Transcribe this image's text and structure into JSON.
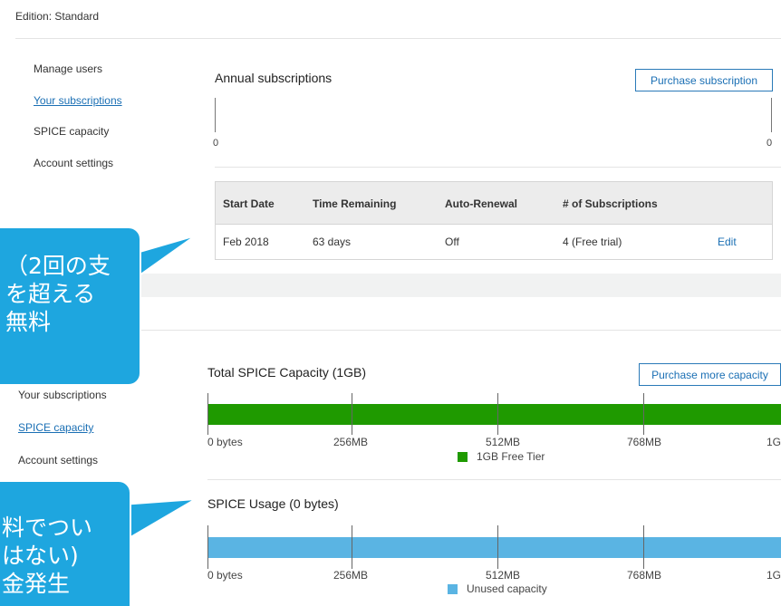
{
  "edition": "Edition: Standard",
  "nav_top": {
    "items": [
      {
        "label": "Manage users"
      },
      {
        "label": "Your subscriptions"
      },
      {
        "label": "SPICE capacity"
      },
      {
        "label": "Account settings"
      }
    ]
  },
  "nav_bottom": {
    "items": [
      {
        "label": "Your subscriptions"
      },
      {
        "label": "SPICE capacity"
      },
      {
        "label": "Account settings"
      }
    ]
  },
  "subscriptions": {
    "title": "Annual subscriptions",
    "button": "Purchase subscription",
    "axis_min": "0",
    "axis_max": "0",
    "table": {
      "headers": [
        "Start Date",
        "Time Remaining",
        "Auto-Renewal",
        "# of Subscriptions"
      ],
      "row": {
        "start_date": "Feb 2018",
        "time_remaining": "63 days",
        "auto_renewal": "Off",
        "subscriptions": "4 (Free trial)",
        "action": "Edit"
      }
    }
  },
  "capacity": {
    "title": "Total SPICE Capacity (1GB)",
    "button": "Purchase more capacity",
    "fill": 1.0,
    "bar_color": "#1f9a00",
    "ticks": [
      "0 bytes",
      "256MB",
      "512MB",
      "768MB",
      "1G"
    ],
    "legend": "1GB Free Tier"
  },
  "usage": {
    "title": "SPICE Usage (0 bytes)",
    "bar_color": "#5ab4e3",
    "ticks": [
      "0 bytes",
      "256MB",
      "512MB",
      "768MB",
      "1G"
    ],
    "legend": "Unused capacity"
  },
  "callout_top": {
    "lines": [
      "（2回の支",
      "を超える",
      "無料"
    ]
  },
  "callout_bottom": {
    "lines": [
      "料でつい",
      "はない)",
      "金発生"
    ]
  },
  "colors": {
    "accent": "#1a6fb4",
    "callout": "#1ea6df"
  }
}
